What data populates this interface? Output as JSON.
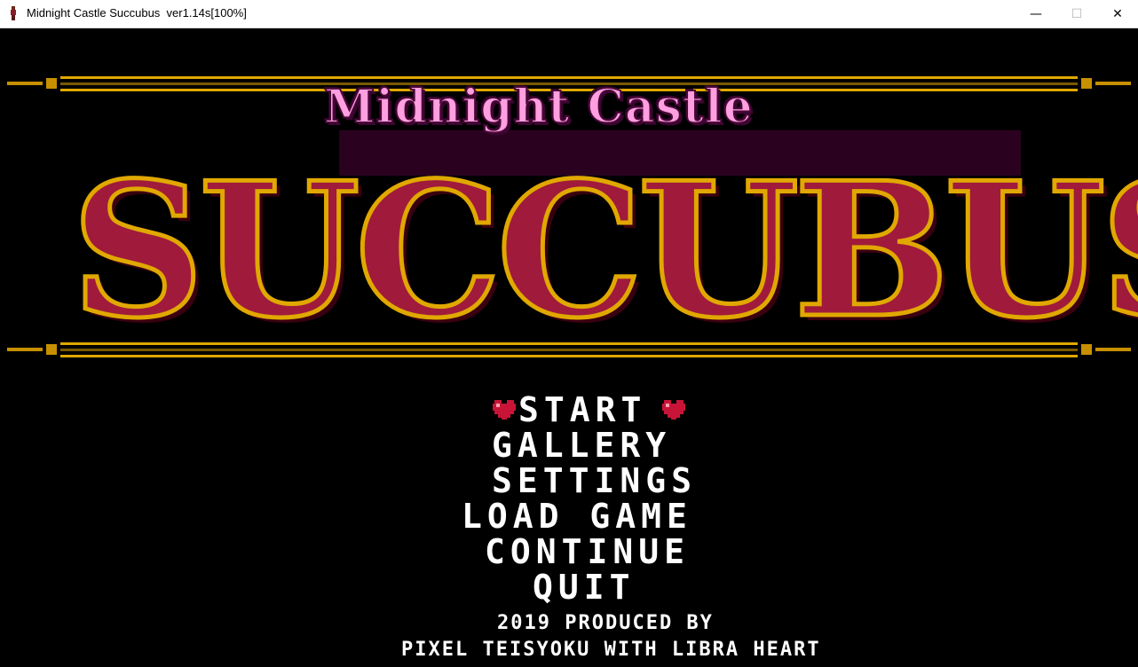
{
  "window": {
    "title": "Midnight Castle Succubus  ver1.14s[100%]",
    "minimize": "—",
    "maximize": "☐",
    "close": "✕"
  },
  "logo": {
    "subtitle": "Midnight Castle",
    "title": "SUCCUBUS"
  },
  "menu": {
    "items": [
      "START",
      "GALLERY",
      "SETTINGS",
      "LOAD GAME",
      "CONTINUE",
      "QUIT"
    ],
    "selected": "START"
  },
  "credits": {
    "line1": "2019 PRODUCED BY",
    "line2": "PIXEL TEISYOKU WITH LIBRA HEART"
  },
  "colors": {
    "background": "#000000",
    "logo_red": "#a01a3c",
    "logo_gold": "#e0a800",
    "subtitle_pink": "#ff9fe0",
    "banner_purple": "#8a1a7a",
    "heart_red": "#c81437",
    "menu_text": "#ffffff"
  }
}
